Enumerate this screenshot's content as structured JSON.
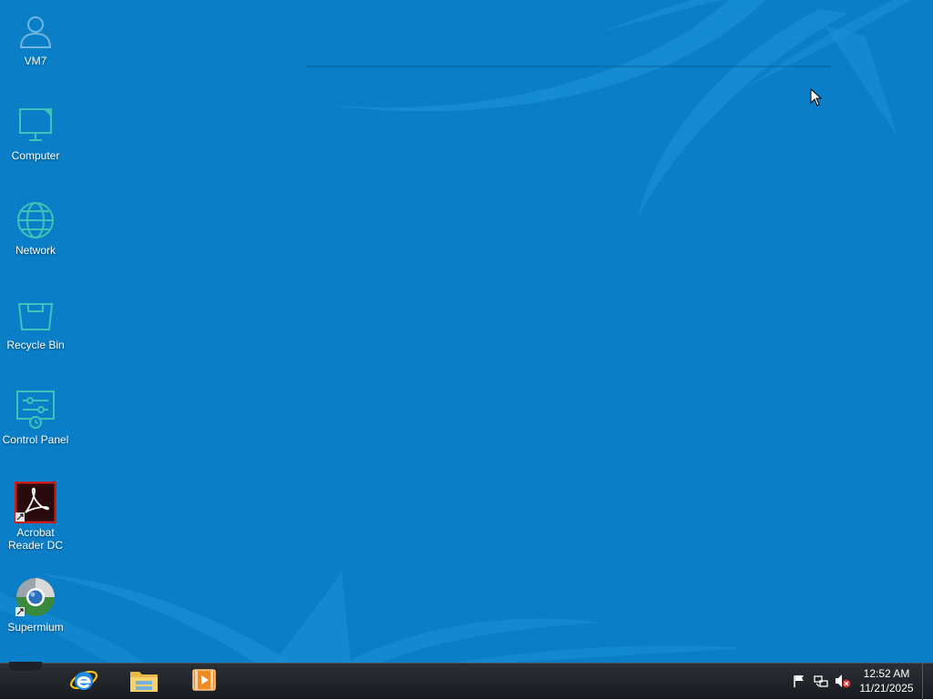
{
  "desktop": {
    "background_color": "#0a7fc7",
    "icons": [
      {
        "label": "VM7",
        "icon": "user-icon"
      },
      {
        "label": "Computer",
        "icon": "monitor-icon"
      },
      {
        "label": "Network",
        "icon": "globe-icon"
      },
      {
        "label": "Recycle Bin",
        "icon": "recycle-bin-icon"
      },
      {
        "label": "Control Panel",
        "icon": "control-panel-icon"
      },
      {
        "label_line1": "Acrobat",
        "label_line2": "Reader DC",
        "icon": "acrobat-reader-icon"
      },
      {
        "label": "Supermium",
        "icon": "supermium-browser-icon"
      }
    ]
  },
  "taskbar": {
    "pinned": [
      {
        "name": "Internet Explorer",
        "icon": "internet-explorer-icon"
      },
      {
        "name": "File Explorer",
        "icon": "file-explorer-icon"
      },
      {
        "name": "Media Player",
        "icon": "media-player-icon"
      }
    ],
    "tray": {
      "icons": [
        "action-center-flag-icon",
        "network-icon",
        "volume-muted-icon"
      ],
      "time": "12:52 AM",
      "date": "11/21/2025"
    }
  }
}
